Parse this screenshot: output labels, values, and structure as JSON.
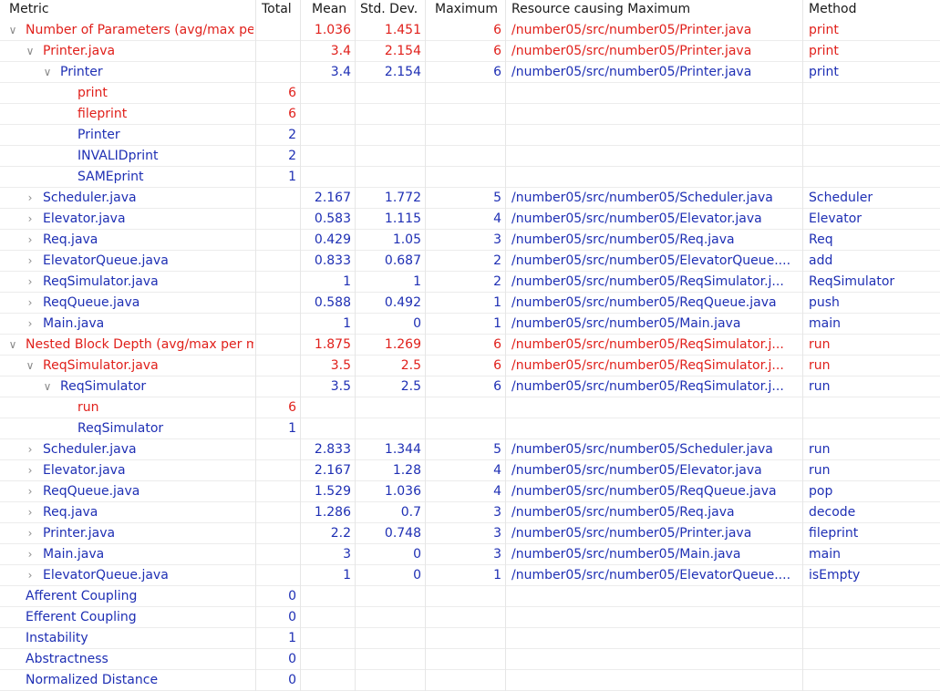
{
  "header": {
    "metric": "Metric",
    "total": "Total",
    "mean": "Mean",
    "std_dev": "Std. Dev.",
    "maximum": "Maximum",
    "resource": "Resource causing Maximum",
    "method": "Method"
  },
  "colors": {
    "highlight": "#e0201b",
    "normal": "#1e2fb4"
  },
  "rows": [
    {
      "level": 0,
      "twisty": "expanded",
      "color": "red",
      "metric": "Number of Parameters (avg/max per method)",
      "total": "",
      "mean": "1.036",
      "std": "1.451",
      "max": "6",
      "resource": "/number05/src/number05/Printer.java",
      "method": "print"
    },
    {
      "level": 1,
      "twisty": "expanded",
      "color": "red",
      "metric": "Printer.java",
      "total": "",
      "mean": "3.4",
      "std": "2.154",
      "max": "6",
      "resource": "/number05/src/number05/Printer.java",
      "method": "print"
    },
    {
      "level": 2,
      "twisty": "expanded",
      "color": "blue",
      "metric": "Printer",
      "total": "",
      "mean": "3.4",
      "std": "2.154",
      "max": "6",
      "resource": "/number05/src/number05/Printer.java",
      "method": "print"
    },
    {
      "level": 3,
      "twisty": "none",
      "color": "red",
      "metric": "print",
      "total": "6",
      "mean": "",
      "std": "",
      "max": "",
      "resource": "",
      "method": ""
    },
    {
      "level": 3,
      "twisty": "none",
      "color": "red",
      "metric": "fileprint",
      "total": "6",
      "mean": "",
      "std": "",
      "max": "",
      "resource": "",
      "method": ""
    },
    {
      "level": 3,
      "twisty": "none",
      "color": "blue",
      "metric": "Printer",
      "total": "2",
      "mean": "",
      "std": "",
      "max": "",
      "resource": "",
      "method": ""
    },
    {
      "level": 3,
      "twisty": "none",
      "color": "blue",
      "metric": "INVALIDprint",
      "total": "2",
      "mean": "",
      "std": "",
      "max": "",
      "resource": "",
      "method": ""
    },
    {
      "level": 3,
      "twisty": "none",
      "color": "blue",
      "metric": "SAMEprint",
      "total": "1",
      "mean": "",
      "std": "",
      "max": "",
      "resource": "",
      "method": ""
    },
    {
      "level": 1,
      "twisty": "collapsed",
      "color": "blue",
      "metric": "Scheduler.java",
      "total": "",
      "mean": "2.167",
      "std": "1.772",
      "max": "5",
      "resource": "/number05/src/number05/Scheduler.java",
      "method": "Scheduler"
    },
    {
      "level": 1,
      "twisty": "collapsed",
      "color": "blue",
      "metric": "Elevator.java",
      "total": "",
      "mean": "0.583",
      "std": "1.115",
      "max": "4",
      "resource": "/number05/src/number05/Elevator.java",
      "method": "Elevator"
    },
    {
      "level": 1,
      "twisty": "collapsed",
      "color": "blue",
      "metric": "Req.java",
      "total": "",
      "mean": "0.429",
      "std": "1.05",
      "max": "3",
      "resource": "/number05/src/number05/Req.java",
      "method": "Req"
    },
    {
      "level": 1,
      "twisty": "collapsed",
      "color": "blue",
      "metric": "ElevatorQueue.java",
      "total": "",
      "mean": "0.833",
      "std": "0.687",
      "max": "2",
      "resource": "/number05/src/number05/ElevatorQueue....",
      "method": "add"
    },
    {
      "level": 1,
      "twisty": "collapsed",
      "color": "blue",
      "metric": "ReqSimulator.java",
      "total": "",
      "mean": "1",
      "std": "1",
      "max": "2",
      "resource": "/number05/src/number05/ReqSimulator.j...",
      "method": "ReqSimulator"
    },
    {
      "level": 1,
      "twisty": "collapsed",
      "color": "blue",
      "metric": "ReqQueue.java",
      "total": "",
      "mean": "0.588",
      "std": "0.492",
      "max": "1",
      "resource": "/number05/src/number05/ReqQueue.java",
      "method": "push"
    },
    {
      "level": 1,
      "twisty": "collapsed",
      "color": "blue",
      "metric": "Main.java",
      "total": "",
      "mean": "1",
      "std": "0",
      "max": "1",
      "resource": "/number05/src/number05/Main.java",
      "method": "main"
    },
    {
      "level": 0,
      "twisty": "expanded",
      "color": "red",
      "metric": "Nested Block Depth (avg/max per method)",
      "total": "",
      "mean": "1.875",
      "std": "1.269",
      "max": "6",
      "resource": "/number05/src/number05/ReqSimulator.j...",
      "method": "run"
    },
    {
      "level": 1,
      "twisty": "expanded",
      "color": "red",
      "metric": "ReqSimulator.java",
      "total": "",
      "mean": "3.5",
      "std": "2.5",
      "max": "6",
      "resource": "/number05/src/number05/ReqSimulator.j...",
      "method": "run"
    },
    {
      "level": 2,
      "twisty": "expanded",
      "color": "blue",
      "metric": "ReqSimulator",
      "total": "",
      "mean": "3.5",
      "std": "2.5",
      "max": "6",
      "resource": "/number05/src/number05/ReqSimulator.j...",
      "method": "run"
    },
    {
      "level": 3,
      "twisty": "none",
      "color": "red",
      "metric": "run",
      "total": "6",
      "mean": "",
      "std": "",
      "max": "",
      "resource": "",
      "method": ""
    },
    {
      "level": 3,
      "twisty": "none",
      "color": "blue",
      "metric": "ReqSimulator",
      "total": "1",
      "mean": "",
      "std": "",
      "max": "",
      "resource": "",
      "method": ""
    },
    {
      "level": 1,
      "twisty": "collapsed",
      "color": "blue",
      "metric": "Scheduler.java",
      "total": "",
      "mean": "2.833",
      "std": "1.344",
      "max": "5",
      "resource": "/number05/src/number05/Scheduler.java",
      "method": "run"
    },
    {
      "level": 1,
      "twisty": "collapsed",
      "color": "blue",
      "metric": "Elevator.java",
      "total": "",
      "mean": "2.167",
      "std": "1.28",
      "max": "4",
      "resource": "/number05/src/number05/Elevator.java",
      "method": "run"
    },
    {
      "level": 1,
      "twisty": "collapsed",
      "color": "blue",
      "metric": "ReqQueue.java",
      "total": "",
      "mean": "1.529",
      "std": "1.036",
      "max": "4",
      "resource": "/number05/src/number05/ReqQueue.java",
      "method": "pop"
    },
    {
      "level": 1,
      "twisty": "collapsed",
      "color": "blue",
      "metric": "Req.java",
      "total": "",
      "mean": "1.286",
      "std": "0.7",
      "max": "3",
      "resource": "/number05/src/number05/Req.java",
      "method": "decode"
    },
    {
      "level": 1,
      "twisty": "collapsed",
      "color": "blue",
      "metric": "Printer.java",
      "total": "",
      "mean": "2.2",
      "std": "0.748",
      "max": "3",
      "resource": "/number05/src/number05/Printer.java",
      "method": "fileprint"
    },
    {
      "level": 1,
      "twisty": "collapsed",
      "color": "blue",
      "metric": "Main.java",
      "total": "",
      "mean": "3",
      "std": "0",
      "max": "3",
      "resource": "/number05/src/number05/Main.java",
      "method": "main"
    },
    {
      "level": 1,
      "twisty": "collapsed",
      "color": "blue",
      "metric": "ElevatorQueue.java",
      "total": "",
      "mean": "1",
      "std": "0",
      "max": "1",
      "resource": "/number05/src/number05/ElevatorQueue....",
      "method": "isEmpty"
    },
    {
      "level": 0,
      "twisty": "none",
      "color": "blue",
      "metric": "Afferent Coupling",
      "total": "0",
      "mean": "",
      "std": "",
      "max": "",
      "resource": "",
      "method": ""
    },
    {
      "level": 0,
      "twisty": "none",
      "color": "blue",
      "metric": "Efferent Coupling",
      "total": "0",
      "mean": "",
      "std": "",
      "max": "",
      "resource": "",
      "method": ""
    },
    {
      "level": 0,
      "twisty": "none",
      "color": "blue",
      "metric": "Instability",
      "total": "1",
      "mean": "",
      "std": "",
      "max": "",
      "resource": "",
      "method": ""
    },
    {
      "level": 0,
      "twisty": "none",
      "color": "blue",
      "metric": "Abstractness",
      "total": "0",
      "mean": "",
      "std": "",
      "max": "",
      "resource": "",
      "method": ""
    },
    {
      "level": 0,
      "twisty": "none",
      "color": "blue",
      "metric": "Normalized Distance",
      "total": "0",
      "mean": "",
      "std": "",
      "max": "",
      "resource": "",
      "method": ""
    }
  ]
}
